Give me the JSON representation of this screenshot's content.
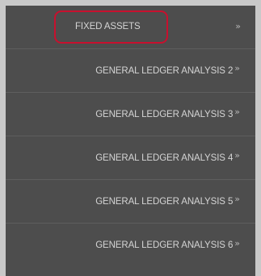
{
  "menu": {
    "items": [
      {
        "label": "FIXED ASSETS",
        "chevron": "»"
      },
      {
        "label": "GENERAL LEDGER ANALYSIS 2",
        "chevron": "»"
      },
      {
        "label": "GENERAL LEDGER ANALYSIS 3",
        "chevron": "»"
      },
      {
        "label": "GENERAL LEDGER ANALYSIS 4",
        "chevron": "»"
      },
      {
        "label": "GENERAL LEDGER ANALYSIS 5",
        "chevron": "»"
      },
      {
        "label": "GENERAL LEDGER ANALYSIS 6",
        "chevron": "»"
      }
    ],
    "highlight_color": "#c8102e",
    "background_color": "#4d4d4d"
  }
}
